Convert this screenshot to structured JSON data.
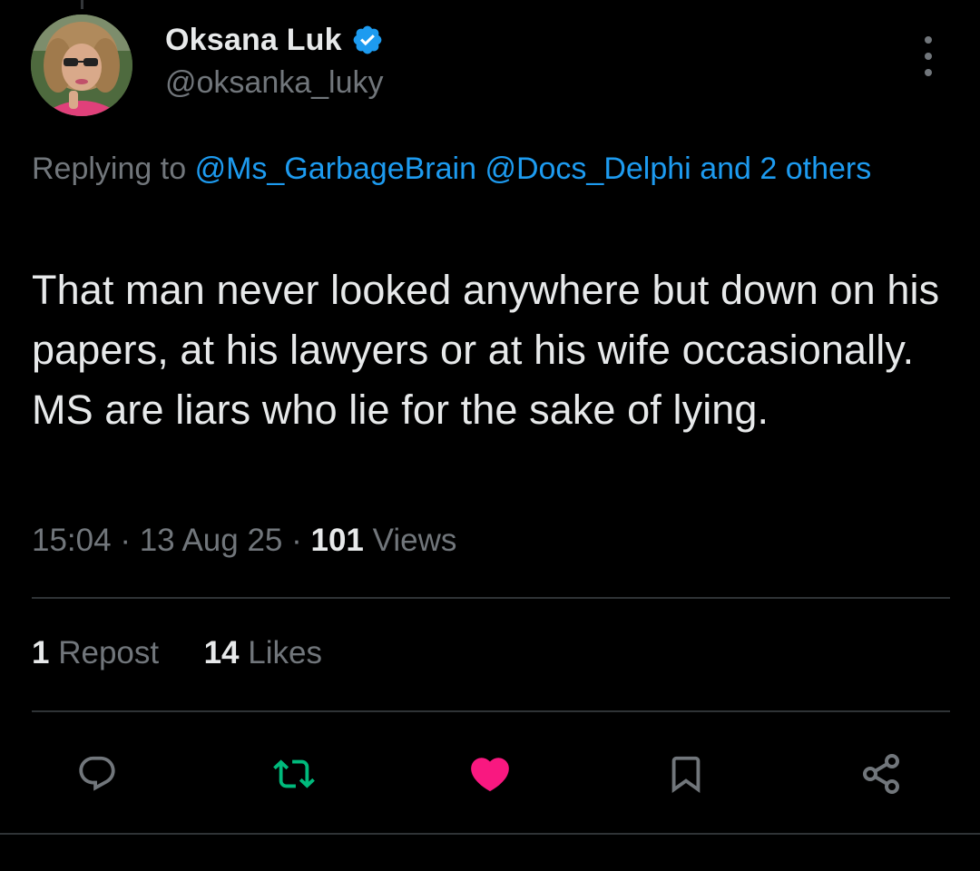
{
  "author": {
    "display_name": "Oksana Luk",
    "handle": "@oksanka_luky",
    "verified": true
  },
  "reply_context": {
    "prefix": "Replying to",
    "mentions": [
      "@Ms_GarbageBrain",
      "@Docs_Delphi"
    ],
    "others": "and 2 others"
  },
  "tweet": {
    "text": "That man never looked anywhere but down on his papers, at his lawyers or at his wife occasionally. MS are liars who lie for the sake of lying.",
    "time": "15:04",
    "date": "13 Aug 25",
    "views_count": "101",
    "views_label": "Views",
    "separator": "·"
  },
  "stats": {
    "reposts_count": "1",
    "reposts_label": "Repost",
    "likes_count": "14",
    "likes_label": "Likes"
  },
  "actions": [
    {
      "name": "reply",
      "icon": "reply-icon",
      "color": "#71767b"
    },
    {
      "name": "repost",
      "icon": "repost-icon",
      "color": "#00ba7c",
      "active": true
    },
    {
      "name": "like",
      "icon": "heart-icon",
      "color": "#f91880",
      "active": true
    },
    {
      "name": "bookmark",
      "icon": "bookmark-icon",
      "color": "#71767b"
    },
    {
      "name": "share",
      "icon": "share-icon",
      "color": "#71767b"
    }
  ],
  "colors": {
    "background": "#000000",
    "text_primary": "#e7e9ea",
    "text_secondary": "#71767b",
    "link": "#1d9bf0",
    "verified": "#1d9bf0",
    "repost_active": "#00ba7c",
    "like_active": "#f91880",
    "divider": "#2f3336"
  }
}
